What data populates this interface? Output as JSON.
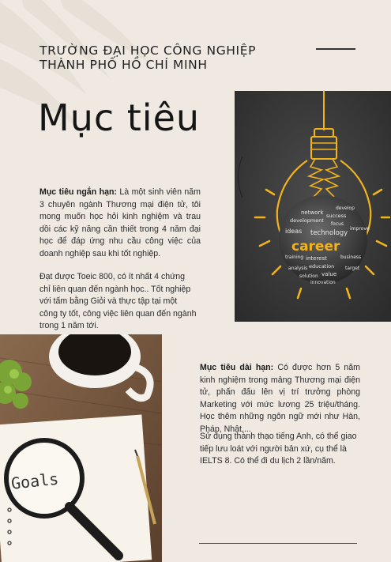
{
  "header": {
    "university_line1": "TRƯỜNG ĐẠI HỌC CÔNG NGHIỆP",
    "university_line2": "THÀNH PHỐ HỒ CHÍ MINH"
  },
  "title": "Mục tiêu",
  "short_term": {
    "label": "Mục tiêu ngắn hạn:",
    "text": " Là một sinh viên năm 3 chuyên ngành Thương mại điện tử, tôi mong muốn học hỏi kinh nghiệm và trau dồi các kỹ năng cần thiết trong 4 năm đại học để đáp ứng nhu cầu công việc của doanh nghiệp sau khi tốt nghiệp.",
    "text2": "Đạt được Toeic 800, có ít nhất 4 chứng chỉ liên quan đến ngành học.. Tốt nghiệp với tấm bằng Giỏi và thực tập tại một công ty tốt, công việc liên quan đến ngành trong 1 năm tới."
  },
  "long_term": {
    "label": "Mục tiêu dài hạn:",
    "text": "  Có được hơn 5 năm kinh nghiệm trong mảng Thương mại điện tử, phấn đấu lên vị trí trưởng phòng Marketing với mức lương 25 triệu/tháng. Học thêm những ngôn ngữ mới như Hàn, Pháp, Nhật,...",
    "text2": "Sử dụng thành thạo tiếng Anh, có thể giao tiếp lưu loát với người bản xứ, cụ thể là IELTS 8. Có thể đi du lịch 2 lần/năm."
  },
  "bulb_image": {
    "main_word": "career",
    "word_cloud": [
      "network",
      "develop",
      "success",
      "development",
      "focus",
      "improve",
      "ideas",
      "technology",
      "interest",
      "business",
      "training",
      "education",
      "analysis",
      "value",
      "solution",
      "target",
      "innovation"
    ]
  },
  "desk_image": {
    "note_word": "Goals"
  },
  "colors": {
    "background": "#efe9e2",
    "bulb_yellow": "#f2b31b",
    "chalkboard": "#3b3b3b"
  }
}
